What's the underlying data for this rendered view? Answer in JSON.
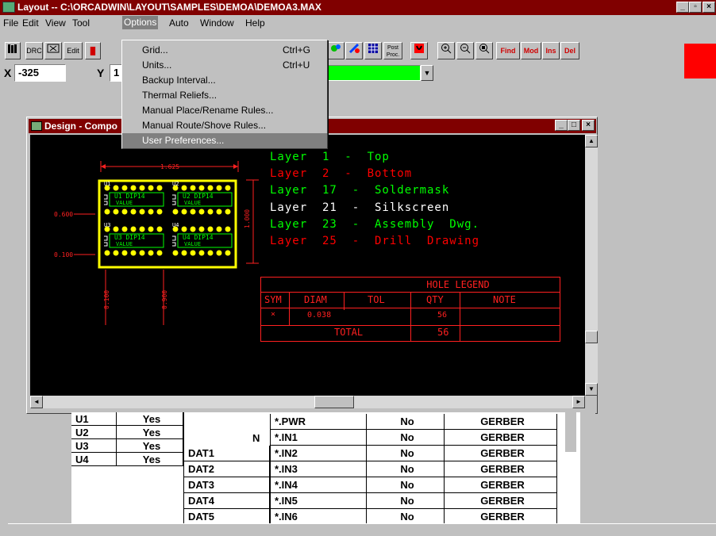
{
  "titlebar": {
    "title": "Layout -- C:\\ORCADWIN\\LAYOUT\\SAMPLES\\DEMOA\\DEMOA3.MAX",
    "btn_min": "_",
    "btn_max": "▫",
    "btn_close": "×"
  },
  "menubar": {
    "items": [
      "File",
      "Edit",
      "View",
      "Tool",
      "Options",
      "Auto",
      "Window",
      "Help"
    ]
  },
  "toolbar": {
    "btn_drc": "DRC",
    "btn_edit": "Edit",
    "btn_post": "Post Proc.",
    "btn_find": "Find",
    "btn_mod": "Mod",
    "btn_ins": "Ins",
    "btn_del": "Del"
  },
  "coords": {
    "x_label": "X",
    "x_value": "-325",
    "y_label": "Y",
    "y_value": "1"
  },
  "options_menu": {
    "items": [
      {
        "label": "Grid...",
        "shortcut": "Ctrl+G"
      },
      {
        "label": "Units...",
        "shortcut": "Ctrl+U"
      },
      {
        "label": "Backup Interval...",
        "shortcut": ""
      },
      {
        "label": "Thermal Reliefs...",
        "shortcut": ""
      },
      {
        "label": "Manual Place/Rename Rules...",
        "shortcut": ""
      },
      {
        "label": "Manual Route/Shove Rules...",
        "shortcut": ""
      },
      {
        "label": "User Preferences...",
        "shortcut": ""
      }
    ]
  },
  "design_window": {
    "title": "Design - Compo",
    "btn_min": "_",
    "btn_max": "□",
    "btn_close": "×"
  },
  "board": {
    "dim_top": "1.625",
    "dim_right": "1.000",
    "dim_left_a": "0.600",
    "dim_left_b": "0.100",
    "dim_bottom_a": "0.100",
    "dim_bottom_b": "0.900",
    "parts": [
      {
        "ref": "U1",
        "pkg": "DIP14",
        "value": "VALUE",
        "num": "U1"
      },
      {
        "ref": "U2",
        "pkg": "DIP14",
        "value": "VALUE",
        "num": "U2"
      },
      {
        "ref": "U3",
        "pkg": "DIP14",
        "value": "VALUE",
        "num": "U3"
      },
      {
        "ref": "U4",
        "pkg": "DIP14",
        "value": "VALUE",
        "num": "U4"
      }
    ]
  },
  "layers": [
    {
      "text": "Layer  1  -  Top",
      "color": "#00ff00"
    },
    {
      "text": "Layer  2  -  Bottom",
      "color": "#ff0000"
    },
    {
      "text": "Layer  17  -  Soldermask",
      "color": "#00ff00"
    },
    {
      "text": "Layer  21  -  Silkscreen",
      "color": "#ffffff"
    },
    {
      "text": "Layer  23  -  Assembly  Dwg.",
      "color": "#00ff00"
    },
    {
      "text": "Layer  25  -  Drill  Drawing",
      "color": "#ff0000"
    }
  ],
  "hole_legend": {
    "title": "HOLE  LEGEND",
    "headers": [
      "SYM",
      "DIAM",
      "TOL",
      "QTY",
      "NOTE"
    ],
    "row": {
      "sym": "×",
      "diam": "0.038",
      "tol": "",
      "qty": "56",
      "note": ""
    },
    "total_label": "TOTAL",
    "total_qty": "56"
  },
  "sheet": {
    "parts": [
      {
        "ref": "U1",
        "val": "Yes"
      },
      {
        "ref": "U2",
        "val": "Yes"
      },
      {
        "ref": "U3",
        "val": "Yes"
      },
      {
        "ref": "U4",
        "val": "Yes"
      }
    ],
    "mid_header": "N",
    "dats": [
      "DAT1",
      "DAT2",
      "DAT3",
      "DAT4",
      "DAT5"
    ],
    "layers": [
      {
        "name": "*.PWR",
        "flag": "No",
        "type": "GERBER"
      },
      {
        "name": "*.IN1",
        "flag": "No",
        "type": "GERBER"
      },
      {
        "name": "*.IN2",
        "flag": "No",
        "type": "GERBER"
      },
      {
        "name": "*.IN3",
        "flag": "No",
        "type": "GERBER"
      },
      {
        "name": "*.IN4",
        "flag": "No",
        "type": "GERBER"
      },
      {
        "name": "*.IN5",
        "flag": "No",
        "type": "GERBER"
      },
      {
        "name": "*.IN6",
        "flag": "No",
        "type": "GERBER"
      }
    ]
  },
  "colors": {
    "titlebar": "#800000",
    "window_bg": "#c0c0c0",
    "board_outline": "#ffff00",
    "status_indicator": "#ff0000",
    "layer_bar": "#00ff00"
  }
}
